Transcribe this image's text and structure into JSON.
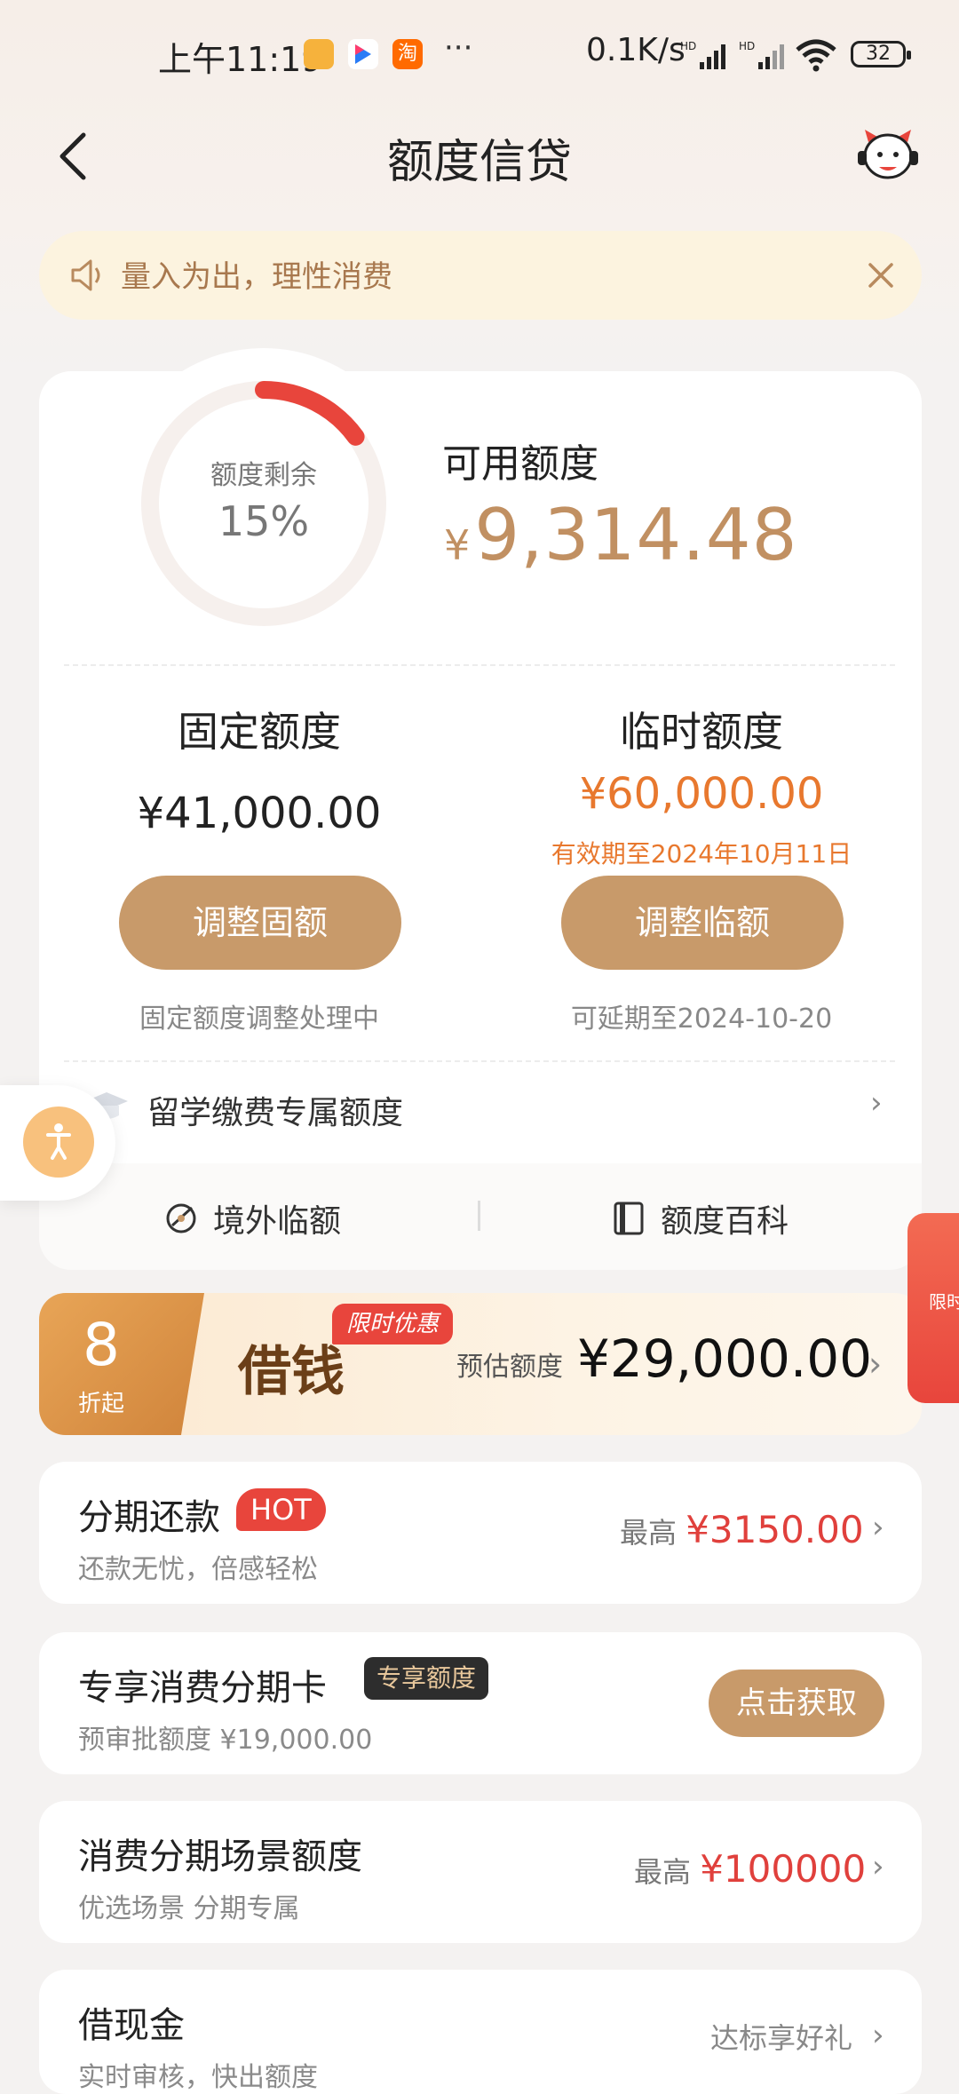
{
  "status_bar": {
    "time": "上午11:19",
    "network_speed": "0.1K/s",
    "battery": "32",
    "more": "···"
  },
  "nav": {
    "title": "额度信贷"
  },
  "notice": {
    "text": "量入为出，理性消费"
  },
  "credit": {
    "ring_label": "额度剩余",
    "ring_percent": "15%",
    "ring_fraction": 0.15,
    "available_label": "可用额度",
    "available_currency": "¥",
    "available_amount": "9,314.48",
    "fixed": {
      "title": "固定额度",
      "amount": "¥41,000.00",
      "button": "调整固额",
      "note": "固定额度调整处理中"
    },
    "temporary": {
      "title": "临时额度",
      "amount": "¥60,000.00",
      "valid": "有效期至2024年10月11日",
      "button": "调整临额",
      "note": "可延期至2024-10-20"
    },
    "study_abroad": "留学缴费专属额度",
    "footer": {
      "overseas": "境外临额",
      "wiki": "额度百科"
    }
  },
  "loan_banner": {
    "discount": "8",
    "discount_unit": "折起",
    "title": "借钱",
    "tag": "限时优惠",
    "estimate_label": "预估额度",
    "estimate_amount": "¥29,000.00"
  },
  "side_promo": {
    "text": "限时"
  },
  "items": {
    "installment": {
      "title": "分期还款",
      "badge": "HOT",
      "subtitle": "还款无忧，倍感轻松",
      "prefix": "最高",
      "amount": "¥3150.00"
    },
    "card": {
      "title": "专享消费分期卡",
      "badge": "专享额度",
      "subtitle": "预审批额度 ¥19,000.00",
      "button": "点击获取"
    },
    "scene": {
      "title": "消费分期场景额度",
      "subtitle": "优选场景 分期专属",
      "prefix": "最高",
      "amount": "¥100000"
    },
    "cash": {
      "title": "借现金",
      "subtitle": "实时审核，快出额度",
      "right": "达标享好礼"
    }
  },
  "colors": {
    "accent_gold": "#c19062",
    "button_gold": "#c89a6a",
    "orange": "#e8782e",
    "red": "#e0403c"
  }
}
